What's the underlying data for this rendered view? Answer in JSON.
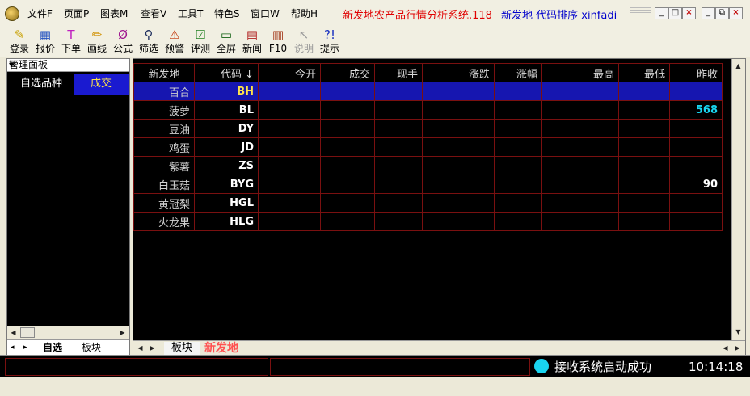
{
  "menu": [
    "文件F",
    "页面P",
    "图表M",
    "查看V",
    "工具T",
    "特色S",
    "窗口W",
    "帮助H"
  ],
  "title": {
    "red": "新发地农产品行情分析系统.118",
    "blue": "新发地 代码排序 xinfadi"
  },
  "window_buttons": {
    "app_min": "_",
    "app_restore": "□",
    "app_close": "×",
    "doc_min": "_",
    "doc_restore": "⧉",
    "doc_close": "×"
  },
  "toolbar": [
    {
      "label": "登录",
      "icon": "pencil-icon",
      "glyph": "✎",
      "color": "#c8a000",
      "enabled": true
    },
    {
      "label": "报价",
      "icon": "quote-icon",
      "glyph": "▦",
      "color": "#2050c0",
      "enabled": true
    },
    {
      "label": "下单",
      "icon": "order-icon",
      "glyph": "T",
      "color": "#c020c0",
      "enabled": true
    },
    {
      "label": "画线",
      "icon": "draw-line-icon",
      "glyph": "✏",
      "color": "#d09000",
      "enabled": true
    },
    {
      "label": "公式",
      "icon": "formula-icon",
      "glyph": "Ø",
      "color": "#a01890",
      "enabled": true
    },
    {
      "label": "筛选",
      "icon": "binoculars-icon",
      "glyph": "⚲",
      "color": "#203060",
      "enabled": true
    },
    {
      "label": "预警",
      "icon": "alarm-icon",
      "glyph": "⚠",
      "color": "#c03000",
      "enabled": true
    },
    {
      "label": "评测",
      "icon": "evaluate-icon",
      "glyph": "☑",
      "color": "#208020",
      "enabled": true
    },
    {
      "label": "全屏",
      "icon": "fullscreen-icon",
      "glyph": "▭",
      "color": "#106010",
      "enabled": true
    },
    {
      "label": "新闻",
      "icon": "news-icon",
      "glyph": "▤",
      "color": "#b02020",
      "enabled": true
    },
    {
      "label": "F10",
      "icon": "books-icon",
      "glyph": "▥",
      "color": "#a03010",
      "enabled": true
    },
    {
      "label": "说明",
      "icon": "help-pointer-icon",
      "glyph": "↖",
      "color": "#9a9a9a",
      "enabled": false
    },
    {
      "label": "提示",
      "icon": "tip-icon",
      "glyph": "?!",
      "color": "#1830c0",
      "enabled": true
    }
  ],
  "left_panel": {
    "title": "管理面板",
    "pin": "▾",
    "close": "×",
    "headers": [
      "自选品种",
      "成交"
    ],
    "tabs": [
      "自选",
      "板块"
    ],
    "tab_nav": [
      "◂",
      "▸"
    ]
  },
  "grid": {
    "columns": [
      "新发地",
      "代码 ↓",
      "今开",
      "成交",
      "现手",
      "涨跌",
      "涨幅",
      "最高",
      "最低",
      "昨收"
    ],
    "rows": [
      {
        "name": "百合",
        "code": "BH",
        "close": "",
        "selected": true
      },
      {
        "name": "菠萝",
        "code": "BL",
        "close": "568",
        "close_color": "#19d5f0"
      },
      {
        "name": "豆油",
        "code": "DY",
        "close": ""
      },
      {
        "name": "鸡蛋",
        "code": "JD",
        "close": ""
      },
      {
        "name": "紫薯",
        "code": "ZS",
        "close": ""
      },
      {
        "name": "白玉菇",
        "code": "BYG",
        "close": "90",
        "close_color": "#ffffff"
      },
      {
        "name": "黄冠梨",
        "code": "HGL",
        "close": ""
      },
      {
        "name": "火龙果",
        "code": "HLG",
        "close": ""
      }
    ],
    "bottom_tabs": [
      "板块",
      "新发地"
    ]
  },
  "status": {
    "message": "接收系统启动成功",
    "time": "10:14:18"
  },
  "colors": {
    "grid_line": "#7a1010",
    "selection": "#1616b0",
    "code_yellow": "#ffe44a",
    "accent_red": "#ff5050"
  }
}
